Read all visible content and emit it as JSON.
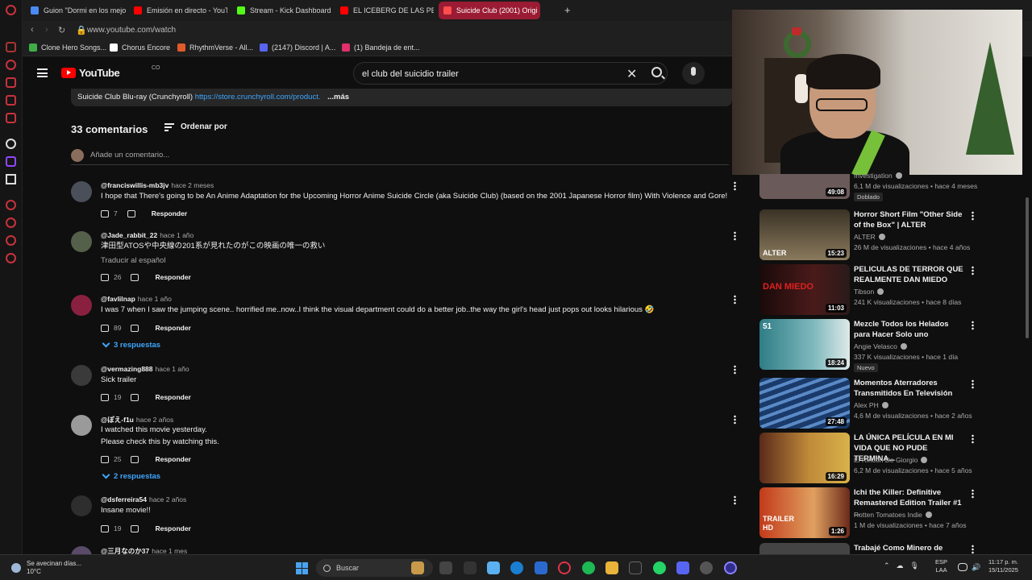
{
  "browser": {
    "tabs": [
      {
        "label": "Guion \"Dormi en los mejo",
        "color": "#4a8af4"
      },
      {
        "label": "Emisión en directo - YouT",
        "color": "#ff0000"
      },
      {
        "label": "Stream - Kick Dashboard",
        "color": "#53fc18"
      },
      {
        "label": "EL ICEBERG DE LAS PELI",
        "color": "#ff0000"
      },
      {
        "label": "Suicide Club (2001) Origi",
        "color": "#ff0000"
      }
    ],
    "new_tab": "+",
    "url": "www.youtube.com/watch",
    "bookmarks": [
      {
        "label": "Clone Hero Songs...",
        "color": "#3fae49"
      },
      {
        "label": "Chorus Encore",
        "color": "#ffffff"
      },
      {
        "label": "RhythmVerse - All...",
        "color": "#e05a2a"
      },
      {
        "label": "(2147) Discord | A...",
        "color": "#5865f2"
      },
      {
        "label": "(1) Bandeja de ent...",
        "color": "#e1306c"
      }
    ]
  },
  "yt": {
    "logo": "YouTube",
    "country": "CO",
    "search_query": "el club del suicidio trailer",
    "clear": "✕"
  },
  "description": {
    "text": "Suicide Club Blu-ray (Crunchyroll)",
    "link": "https://store.crunchyroll.com/product.",
    "more": "...más"
  },
  "comments_header": {
    "count": "33 comentarios",
    "sort": "Ordenar por",
    "add_placeholder": "Añade un comentario..."
  },
  "comments": [
    {
      "author": "@franciswillis-mb3jv",
      "time": "hace 2 meses",
      "text": "I hope that There's going to be An Anime Adaptation for the Upcoming Horror Anime Suicide Circle (aka Suicide Club) (based on the 2001 Japanese Horror film) With Violence and Gore!",
      "likes": "7",
      "reply": "Responder"
    },
    {
      "author": "@Jade_rabbit_22",
      "time": "hace 1 año",
      "text": "津田型ATOSや中央線の201系が見れたのがこの映画の唯一の救い",
      "translate": "Traducir al español",
      "likes": "26",
      "reply": "Responder"
    },
    {
      "author": "@favlilnap",
      "time": "hace 1 año",
      "text": "I was 7 when I saw the jumping scene.. horrified me..now..I think the visual department could do a better job..the way the girl's head just pops out looks hilarious 🤣",
      "likes": "89",
      "reply": "Responder",
      "replies": "3 respuestas"
    },
    {
      "author": "@vermazing888",
      "time": "hace 1 año",
      "text": "Sick trailer",
      "likes": "19",
      "reply": "Responder"
    },
    {
      "author": "@ぽえ-f1u",
      "time": "hace 2 años",
      "text": "I watched this movie yesterday.",
      "text2": "Please check this by watching this.",
      "likes": "25",
      "reply": "Responder",
      "replies": "2 respuestas"
    },
    {
      "author": "@dsferreira54",
      "time": "hace 2 años",
      "text": "Insane movie!!",
      "likes": "19",
      "reply": "Responder"
    },
    {
      "author": "@三月なのか37",
      "time": "hace 1 mes",
      "text": ""
    }
  ],
  "videos": [
    {
      "title": "",
      "channel": "Investigation",
      "views": "6,1 M de visualizaciones",
      "age": "hace 4 meses",
      "badge": "Doblado",
      "duration": "49:08",
      "color": "#6b5a5a"
    },
    {
      "title": "Horror Short Film \"Other Side of the Box\" | ALTER",
      "channel": "ALTER",
      "views": "26 M de visualizaciones",
      "age": "hace 4 años",
      "duration": "15:23",
      "thumb_text": "ALTER",
      "color": "#8a7a5c"
    },
    {
      "title": "PELICULAS DE TERROR QUE REALMENTE DAN MIEDO",
      "channel": "Tibson",
      "views": "241 K visualizaciones",
      "age": "hace 8 días",
      "duration": "11:03",
      "thumb_text": "DAN MIEDO",
      "color": "#4a1a1a"
    },
    {
      "title": "Mezcle Todos los Helados para Hacer Solo uno",
      "channel": "Angie Velasco",
      "views": "337 K visualizaciones",
      "age": "hace 1 día",
      "badge": "Nuevo",
      "duration": "18:24",
      "thumb_text": "51",
      "color": "#2f7d86"
    },
    {
      "title": "Momentos Aterradores Transmitidos En Televisión",
      "channel": "Alex PH",
      "views": "4,6 M de visualizaciones",
      "age": "hace 2 años",
      "duration": "27:48",
      "color": "#3a5a86"
    },
    {
      "title": "LA ÚNICA PELÍCULA EN MI VIDA QUE NO PUDE TERMINA...",
      "channel": "El Rincón De Giorgio",
      "views": "6,2 M de visualizaciones",
      "age": "hace 5 años",
      "duration": "16:29",
      "color": "#8a5a2a"
    },
    {
      "title": "Ichi the Killer: Definitive Remastered Edition Trailer #1 ...",
      "channel": "Rotten Tomatoes Indie",
      "views": "1 M de visualizaciones",
      "age": "hace 7 años",
      "duration": "1:26",
      "thumb_text": "TRAILER HD",
      "color": "#c23a1a"
    },
    {
      "title": "Trabajé Como Minero de",
      "color": "#444"
    }
  ],
  "taskbar": {
    "weather_title": "Se avecinan días...",
    "weather_temp": "10°C",
    "search": "Buscar",
    "lang1": "ESP",
    "lang2": "LAA",
    "time": "11:17 p. m.",
    "date": "15/11/2025"
  }
}
